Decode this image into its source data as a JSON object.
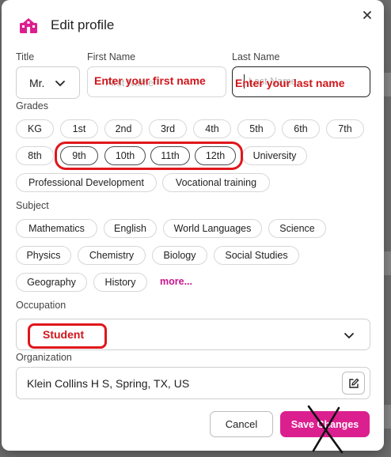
{
  "dialog": {
    "title": "Edit profile"
  },
  "form": {
    "title_label": "Title",
    "title_value": "Mr.",
    "first_name_label": "First Name",
    "first_name_placeholder": "First Name",
    "last_name_label": "Last Name",
    "last_name_placeholder": "Last Name",
    "grades_label": "Grades",
    "grades": [
      "KG",
      "1st",
      "2nd",
      "3rd",
      "4th",
      "5th",
      "6th",
      "7th",
      "8th",
      "9th",
      "10th",
      "11th",
      "12th",
      "University",
      "Professional Development",
      "Vocational training"
    ],
    "subject_label": "Subject",
    "subjects": [
      "Mathematics",
      "English",
      "World Languages",
      "Science",
      "Physics",
      "Chemistry",
      "Biology",
      "Social Studies",
      "Geography",
      "History"
    ],
    "more_label": "more...",
    "occupation_label": "Occupation",
    "occupation_value": "Student",
    "organization_label": "Organization",
    "organization_value": "Klein Collins H S, Spring, TX, US"
  },
  "buttons": {
    "cancel": "Cancel",
    "save": "Save Changes"
  },
  "annotations": {
    "first_name_note": "Enter your first name",
    "last_name_note": "Enter your last name"
  },
  "colors": {
    "accent": "#dc1f8f",
    "annotation": "#e0161b"
  }
}
